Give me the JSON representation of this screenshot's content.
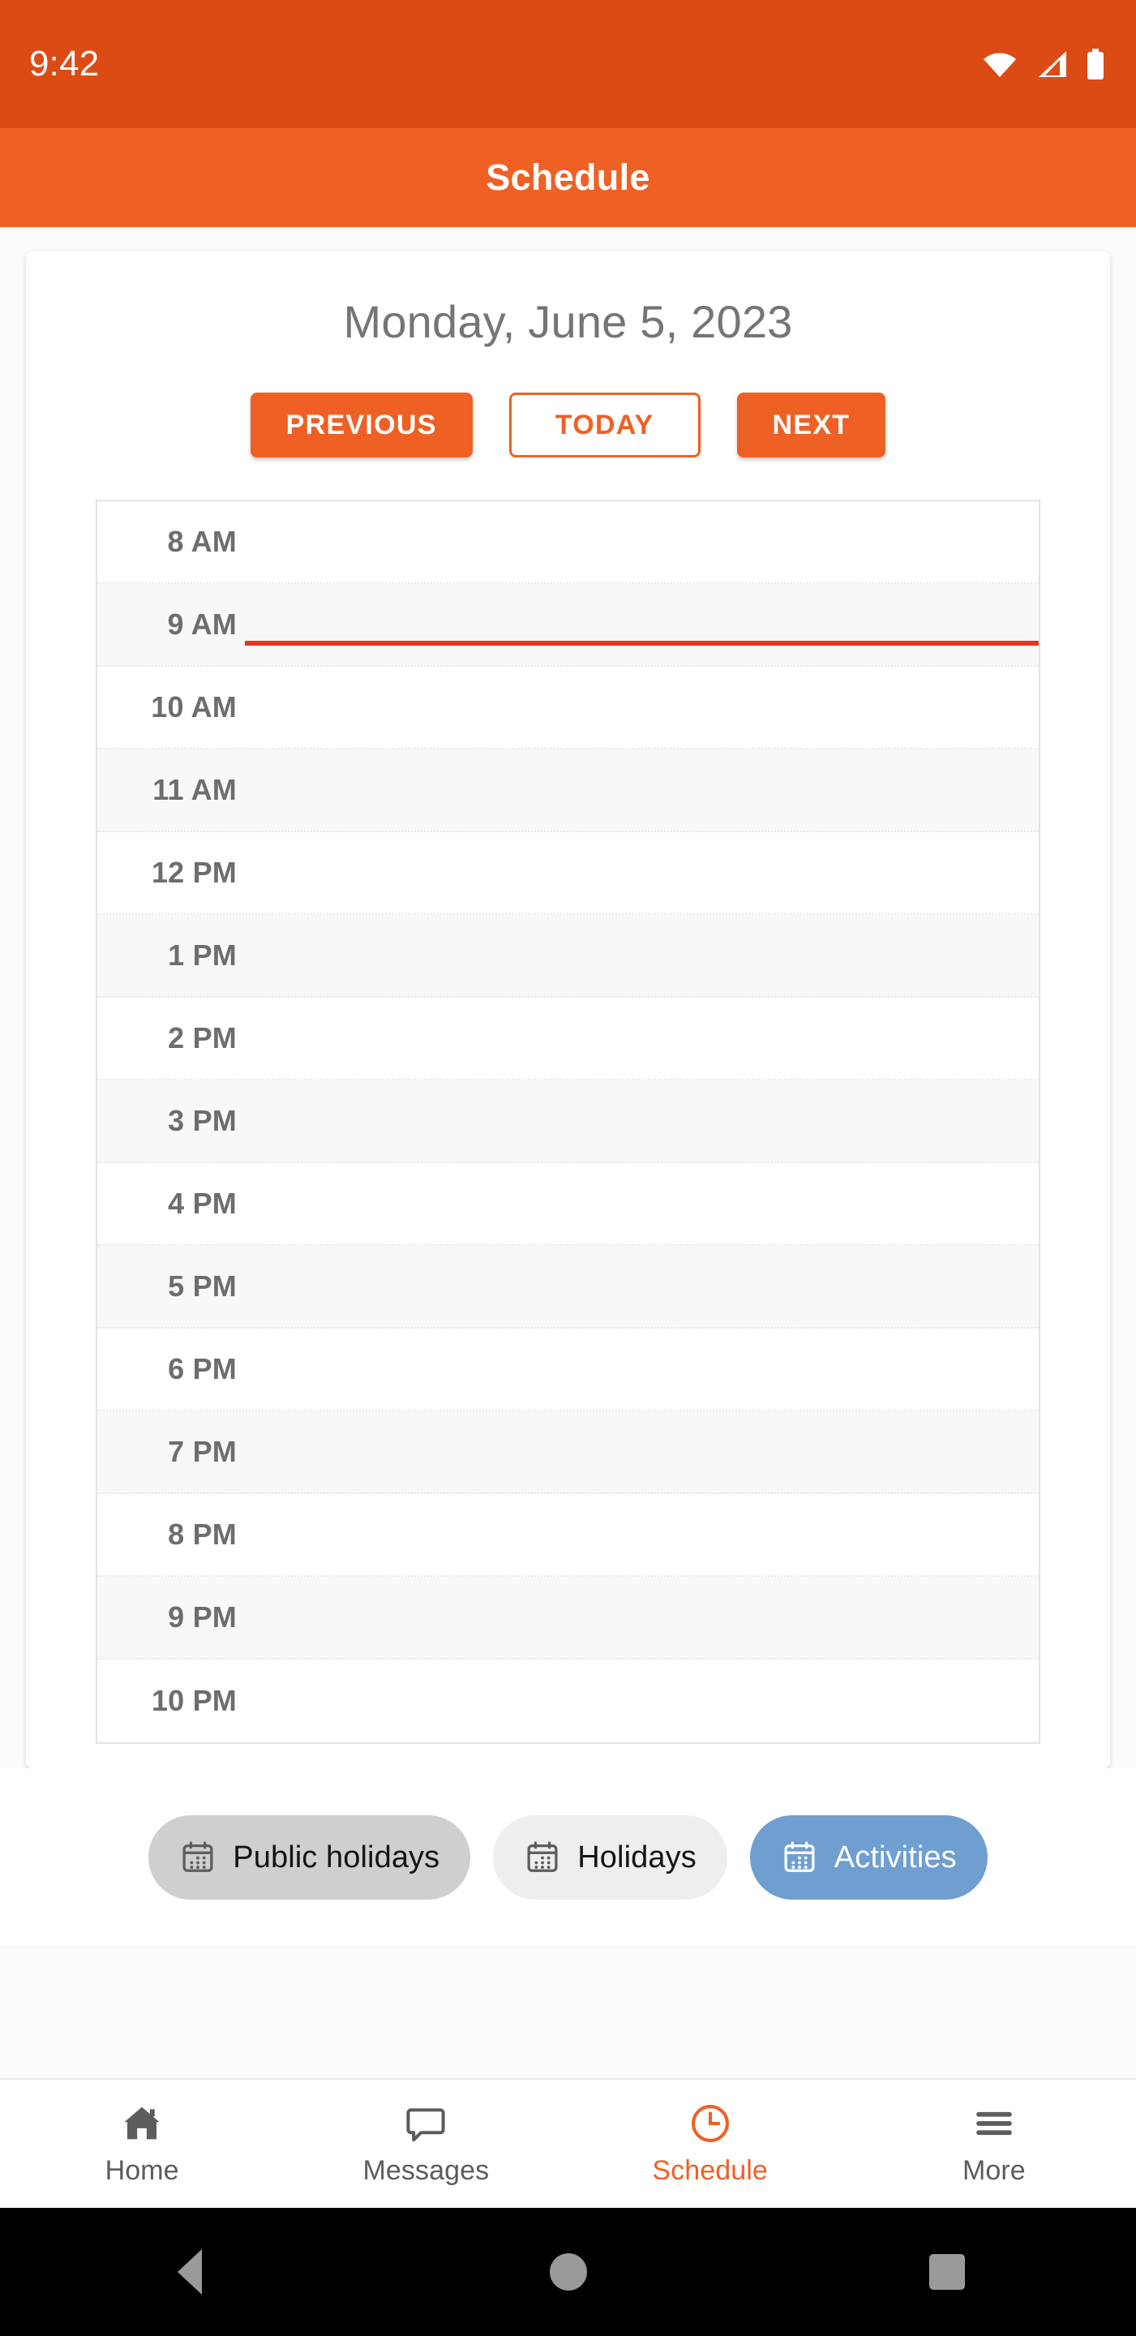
{
  "status_bar": {
    "time": "9:42",
    "icons": [
      "wifi-icon",
      "cellular-signal-icon",
      "battery-icon"
    ]
  },
  "app_bar": {
    "title": "Schedule"
  },
  "schedule_card": {
    "date_heading": "Monday, June 5, 2023",
    "buttons": [
      {
        "label": "PREVIOUS",
        "style": "filled"
      },
      {
        "label": "TODAY",
        "style": "outlined"
      },
      {
        "label": "NEXT",
        "style": "filled"
      }
    ],
    "time_slots": [
      "8 AM",
      "9 AM",
      "10 AM",
      "11 AM",
      "12 PM",
      "1 PM",
      "2 PM",
      "3 PM",
      "4 PM",
      "5 PM",
      "6 PM",
      "7 PM",
      "8 PM",
      "9 PM",
      "10 PM"
    ],
    "current_time_indicator": {
      "row_index": 1,
      "row_label": "9 AM",
      "offset_percent": 70,
      "color": "#e8341c"
    }
  },
  "filter_chips": [
    {
      "label": "Public holidays",
      "icon": "calendar-icon",
      "tone": "tone-dark",
      "selected": false
    },
    {
      "label": "Holidays",
      "icon": "calendar-icon",
      "tone": "tone-light",
      "selected": false
    },
    {
      "label": "Activities",
      "icon": "calendar-icon",
      "tone": "tone-blue",
      "selected": true
    }
  ],
  "bottom_nav": [
    {
      "label": "Home",
      "icon": "home-icon",
      "active": false
    },
    {
      "label": "Messages",
      "icon": "message-bubble-icon",
      "active": false
    },
    {
      "label": "Schedule",
      "icon": "clock-icon",
      "active": true
    },
    {
      "label": "More",
      "icon": "hamburger-menu-icon",
      "active": false
    }
  ],
  "android_nav": {
    "back": "back-button",
    "home": "home-button",
    "recents": "recents-button"
  },
  "colors": {
    "status_bar": "#dd4b14",
    "app_bar": "#ef6024",
    "accent": "#ef6024",
    "current_time": "#e8341c",
    "chip_blue": "#6f9ed1"
  }
}
